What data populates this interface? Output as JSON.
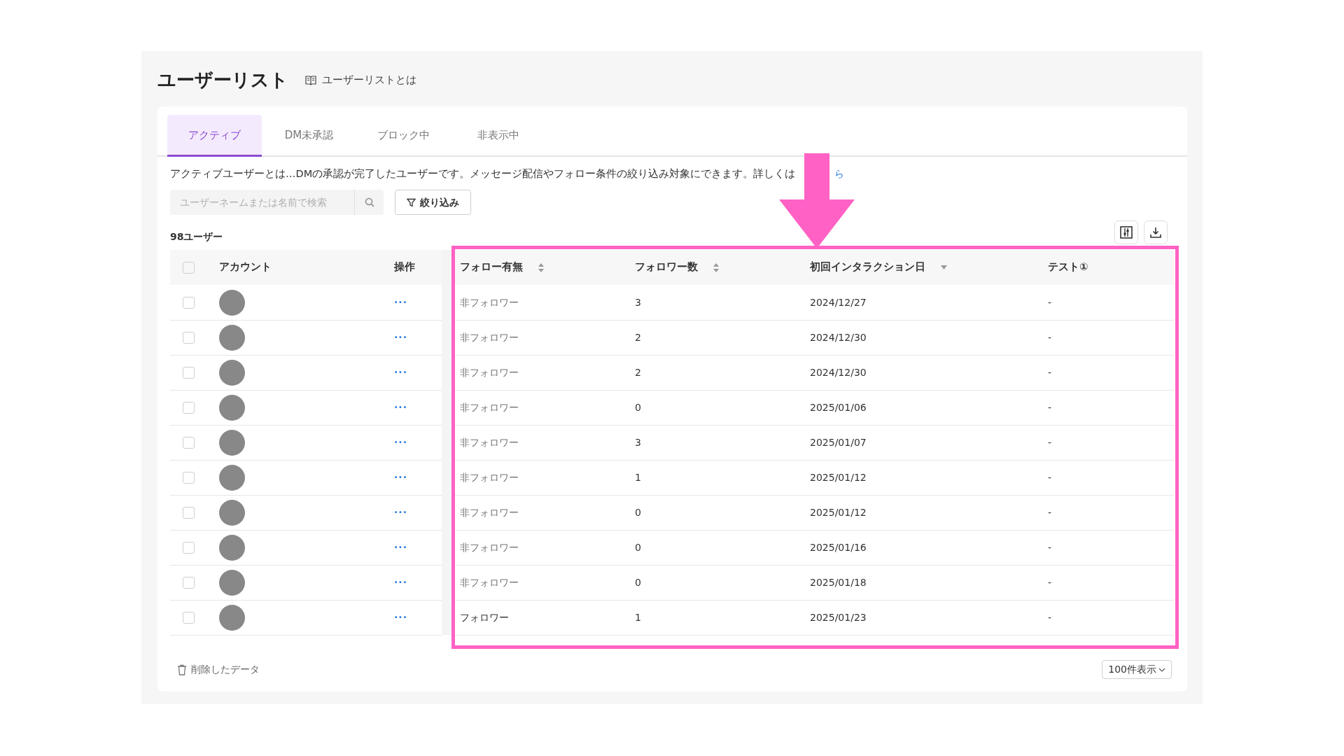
{
  "page": {
    "title": "ユーザーリスト",
    "help_link": "ユーザーリストとは"
  },
  "tabs": [
    {
      "label": "アクティブ",
      "selected": true
    },
    {
      "label": "DM未承認",
      "selected": false
    },
    {
      "label": "ブロック中",
      "selected": false
    },
    {
      "label": "非表示中",
      "selected": false
    }
  ],
  "description": {
    "text": "アクティブユーザーとは…DMの承認が完了したユーザーです。メッセージ配信やフォロー条件の絞り込み対象にできます。詳しくは",
    "link": "ら"
  },
  "search": {
    "placeholder": "ユーザーネームまたは名前で検索"
  },
  "filter_button": "絞り込み",
  "count": "98ユーザー",
  "table": {
    "select_all": {
      "checked": false
    },
    "columns": [
      {
        "label": "アカウント",
        "sortable": false
      },
      {
        "label": "操作",
        "sortable": false
      },
      {
        "label": "フォロー有無",
        "sortable": true,
        "sorted": false
      },
      {
        "label": "フォロワー数",
        "sortable": true,
        "sorted": false
      },
      {
        "label": "初回インタラクション日",
        "sortable": true,
        "sorted": true
      },
      {
        "label": "テスト①",
        "sortable": false
      }
    ],
    "rows": [
      {
        "checked": false,
        "actions": "···",
        "follow_status": "非フォロワー",
        "following": false,
        "followers": "3",
        "first_interaction": "2024/12/27",
        "test": "-"
      },
      {
        "checked": false,
        "actions": "···",
        "follow_status": "非フォロワー",
        "following": false,
        "followers": "2",
        "first_interaction": "2024/12/30",
        "test": "-"
      },
      {
        "checked": false,
        "actions": "···",
        "follow_status": "非フォロワー",
        "following": false,
        "followers": "2",
        "first_interaction": "2024/12/30",
        "test": "-"
      },
      {
        "checked": false,
        "actions": "···",
        "follow_status": "非フォロワー",
        "following": false,
        "followers": "0",
        "first_interaction": "2025/01/06",
        "test": "-"
      },
      {
        "checked": false,
        "actions": "···",
        "follow_status": "非フォロワー",
        "following": false,
        "followers": "3",
        "first_interaction": "2025/01/07",
        "test": "-"
      },
      {
        "checked": false,
        "actions": "···",
        "follow_status": "非フォロワー",
        "following": false,
        "followers": "1",
        "first_interaction": "2025/01/12",
        "test": "-"
      },
      {
        "checked": false,
        "actions": "···",
        "follow_status": "非フォロワー",
        "following": false,
        "followers": "0",
        "first_interaction": "2025/01/12",
        "test": "-"
      },
      {
        "checked": false,
        "actions": "···",
        "follow_status": "非フォロワー",
        "following": false,
        "followers": "0",
        "first_interaction": "2025/01/16",
        "test": "-"
      },
      {
        "checked": false,
        "actions": "···",
        "follow_status": "非フォロワー",
        "following": false,
        "followers": "0",
        "first_interaction": "2025/01/18",
        "test": "-"
      },
      {
        "checked": false,
        "actions": "···",
        "follow_status": "フォロワー",
        "following": true,
        "followers": "1",
        "first_interaction": "2025/01/23",
        "test": "-"
      }
    ]
  },
  "footer": {
    "deleted_data": "削除したデータ",
    "page_size": "100件表示"
  }
}
